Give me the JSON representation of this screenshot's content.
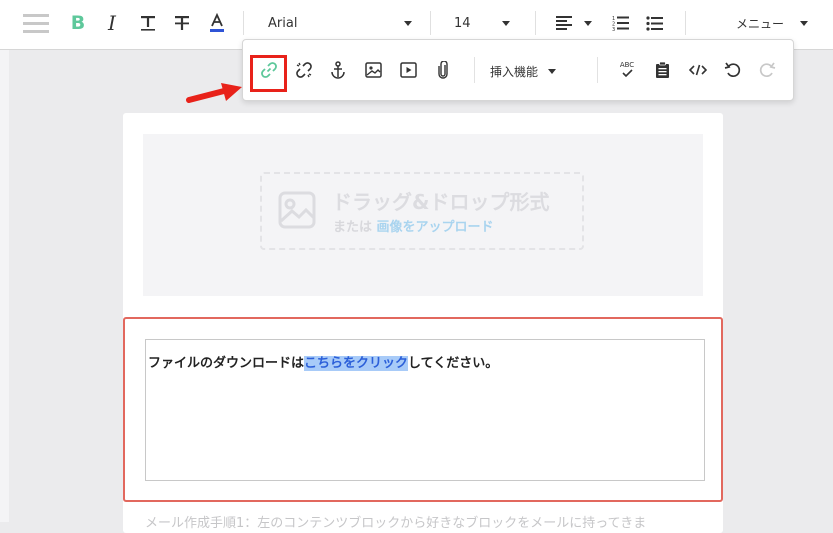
{
  "toolbar": {
    "bold_label": "B",
    "italic_label": "I",
    "font_family": "Arial",
    "font_size": "14",
    "menu_label": "メニュー"
  },
  "editor": {
    "image_block": {
      "title": "ドラッグ&ドロップ形式",
      "sub_prefix": "または",
      "sub_link": "画像をアップロード"
    },
    "text_block": {
      "before": "ファイルのダウンロードは",
      "selected": "こちらをクリック",
      "after": "してください。"
    },
    "footer_note": "メール作成手順1：左のコンテンツブロックから好きなブロックをメールに持ってきま"
  },
  "popup": {
    "insert_label": "挿入機能",
    "spellcheck_label": "ABC",
    "buttons": [
      {
        "name": "insert-link",
        "icon": "link-icon",
        "active": true
      },
      {
        "name": "remove-link",
        "icon": "unlink-icon"
      },
      {
        "name": "anchor",
        "icon": "anchor-icon"
      },
      {
        "name": "insert-image",
        "icon": "image-icon"
      },
      {
        "name": "insert-video",
        "icon": "video-icon"
      },
      {
        "name": "attach-file",
        "icon": "paperclip-icon"
      },
      {
        "name": "spellcheck",
        "icon": "spellcheck-icon"
      },
      {
        "name": "paste-text",
        "icon": "clipboard-icon"
      },
      {
        "name": "source-code",
        "icon": "code-icon"
      },
      {
        "name": "undo",
        "icon": "undo-icon"
      },
      {
        "name": "redo",
        "icon": "redo-icon",
        "disabled": true
      }
    ]
  },
  "colors": {
    "accent_green": "#5ec89b",
    "selection_bg": "#a8cbf8",
    "selection_text": "#2b5fd9",
    "highlight_red": "#e8221a",
    "block_border": "#e2685e"
  }
}
